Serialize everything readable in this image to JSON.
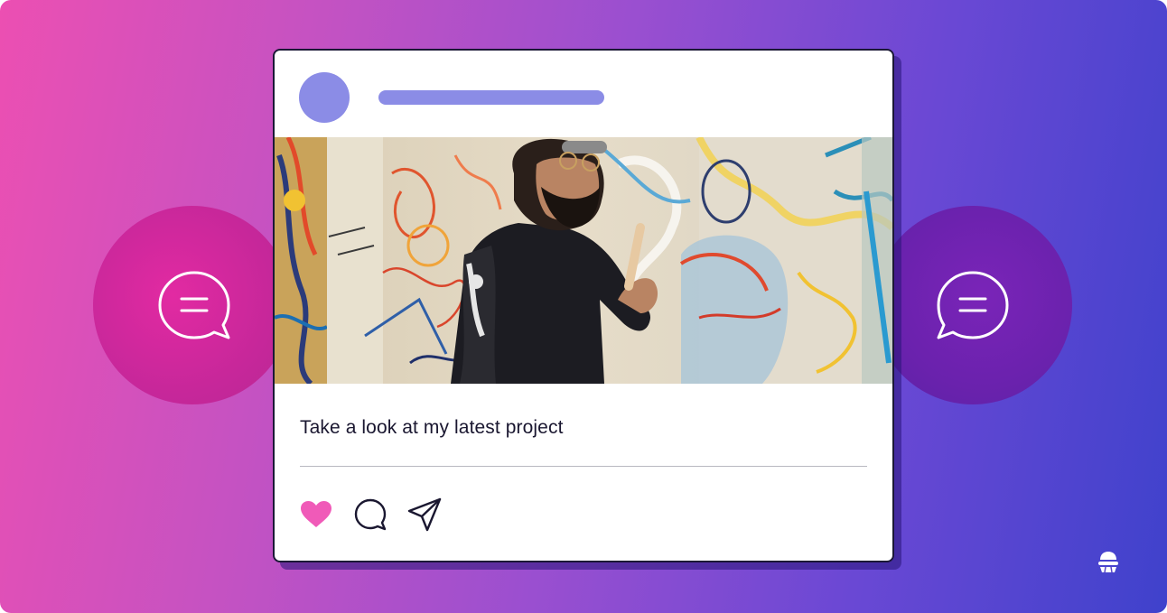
{
  "post": {
    "caption": "Take a look at my latest project"
  },
  "icons": {
    "left_bubble": "chat-bubble-icon",
    "right_bubble": "chat-bubble-icon",
    "like": "heart-icon",
    "comment": "comment-icon",
    "share": "send-icon",
    "logo": "brand-logo-icon"
  },
  "colors": {
    "gradient_start": "#ec4fb2",
    "gradient_end": "#3f42cc",
    "avatar": "#8b8ce6",
    "heart": "#f05ab8",
    "card_border": "#1b1836"
  }
}
